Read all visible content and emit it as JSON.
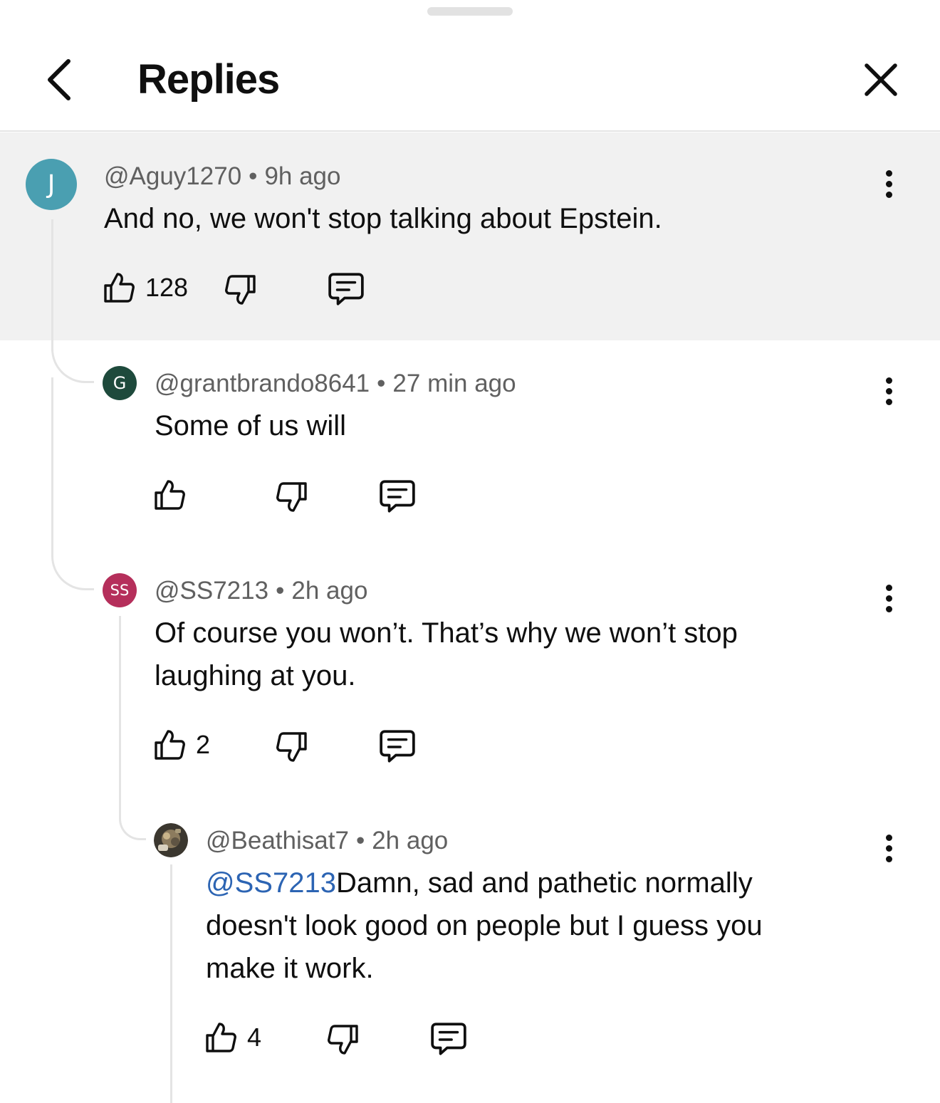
{
  "header": {
    "title": "Replies",
    "back_icon": "chevron-left-icon",
    "close_icon": "close-icon"
  },
  "comments": [
    {
      "avatar_letter": "J",
      "avatar_color": "#4a9fb1",
      "handle": "@Aguy1270",
      "time": "9h ago",
      "text": "And no, we won't stop talking about Epstein.",
      "likes": "128"
    },
    {
      "avatar_letter": "G",
      "avatar_color": "#1e4a3c",
      "handle": "@grantbrando8641",
      "time": "27 min ago",
      "text": "Some of us will",
      "likes": ""
    },
    {
      "avatar_letter": "SS",
      "avatar_color": "#b52f5b",
      "handle": "@SS7213",
      "time": "2h ago",
      "text_line1": "Of course you won’t. That’s why we won’t stop",
      "text_line2": "laughing at you.",
      "likes": "2"
    },
    {
      "avatar_letter": "",
      "avatar_color": "#5a5346",
      "handle": "@Beathisat7",
      "time": "2h ago",
      "mention": "@SS7213",
      "text_line1": "Damn, sad and pathetic normally",
      "text_line2": "doesn't look good on people but I guess you",
      "text_line3": "make it work.",
      "likes": "4"
    }
  ],
  "separator": "•",
  "colors": {
    "highlight_bg": "#f1f1f1",
    "mention": "#2c64b3",
    "meta_text": "#606060"
  }
}
